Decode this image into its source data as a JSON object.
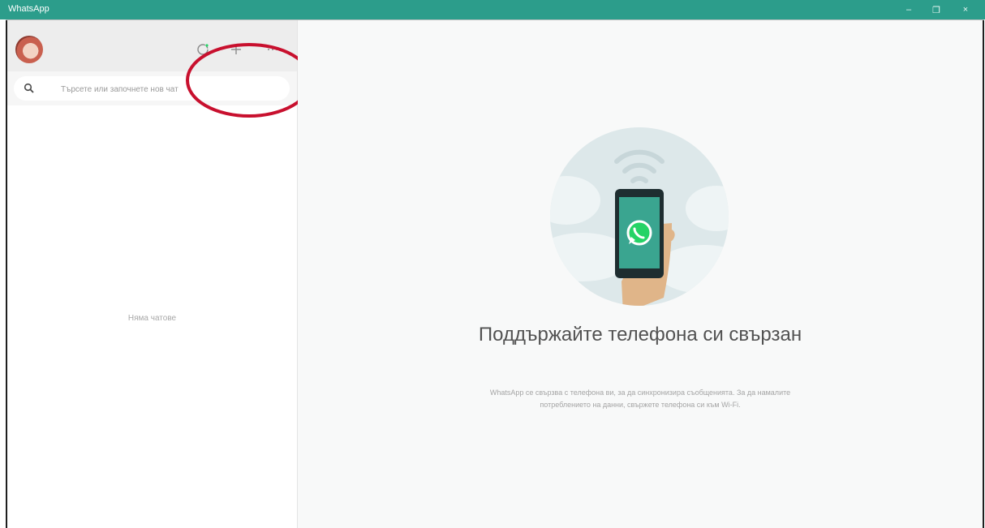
{
  "window": {
    "title": "WhatsApp",
    "controls": {
      "minimize": "–",
      "restore": "❐",
      "close": "×"
    }
  },
  "sidebar": {
    "header": {
      "icons": [
        "status-icon",
        "new-chat-icon",
        "menu-icon"
      ]
    },
    "search": {
      "placeholder": "Търсете или започнете нов чат"
    },
    "empty_text": "Няма чатове"
  },
  "main": {
    "heading": "Поддържайте телефона си свързан",
    "subtext": "WhatsApp се свързва с телефона ви, за да синхронизира съобщенията. За да намалите потреблението на данни, свържете телефона си към Wi-Fi."
  },
  "colors": {
    "titlebar": "#2c9d8b",
    "annotation": "#c8102e",
    "whatsapp_green": "#25d366"
  }
}
